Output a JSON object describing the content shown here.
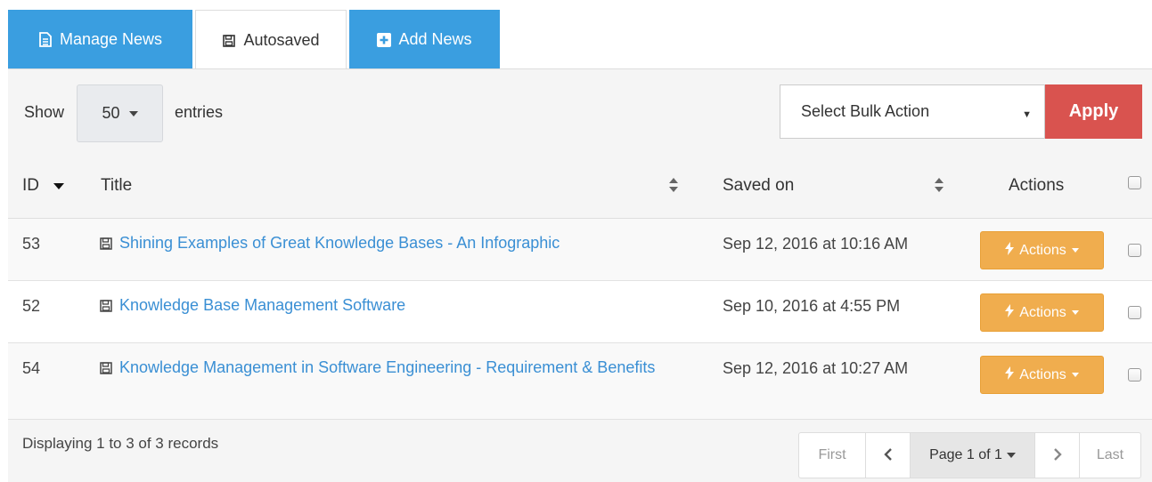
{
  "tabs": {
    "manage": "Manage News",
    "autosaved": "Autosaved",
    "add": "Add News"
  },
  "toolbar": {
    "show_label": "Show",
    "page_size": "50",
    "entries_label": "entries",
    "bulk_action_placeholder": "Select Bulk Action",
    "apply_label": "Apply"
  },
  "table": {
    "headers": {
      "id": "ID",
      "title": "Title",
      "saved_on": "Saved on",
      "actions": "Actions"
    },
    "rows": [
      {
        "id": "53",
        "title": "Shining Examples of Great Knowledge Bases - An Infographic",
        "saved_on": "Sep 12, 2016 at 10:16 AM",
        "action_label": "Actions"
      },
      {
        "id": "52",
        "title": "Knowledge Base Management Software",
        "saved_on": "Sep 10, 2016 at 4:55 PM",
        "action_label": "Actions"
      },
      {
        "id": "54",
        "title": "Knowledge Management in Software Engineering - Requirement & Benefits",
        "saved_on": "Sep 12, 2016 at 10:27 AM",
        "action_label": "Actions"
      }
    ]
  },
  "footer": {
    "records_text": "Displaying 1 to 3 of 3 records",
    "first": "First",
    "page": "Page 1 of 1",
    "last": "Last"
  },
  "colors": {
    "tab_blue": "#3a9ee0",
    "apply_red": "#d9534f",
    "action_orange": "#f0ad4e",
    "link_blue": "#3a8fd4"
  }
}
